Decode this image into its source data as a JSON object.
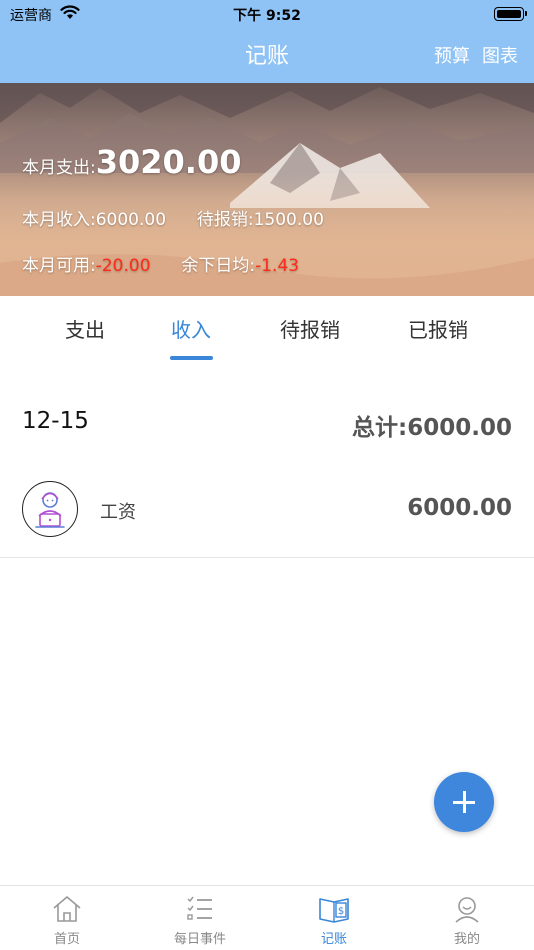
{
  "status_bar": {
    "carrier": "运营商",
    "time": "下午 9:52"
  },
  "nav": {
    "title": "记账",
    "budget": "预算",
    "chart": "图表"
  },
  "summary": {
    "expense_label": "本月支出:",
    "expense_value": "3020.00",
    "income_label": "本月收入:",
    "income_value": "6000.00",
    "pending_label": "待报销:",
    "pending_value": "1500.00",
    "available_label": "本月可用:",
    "available_value": "-20.00",
    "daily_label": "余下日均:",
    "daily_value": "-1.43"
  },
  "tabs": [
    {
      "label": "支出",
      "active": false
    },
    {
      "label": "收入",
      "active": true
    },
    {
      "label": "待报销",
      "active": false
    },
    {
      "label": "已报销",
      "active": false
    }
  ],
  "group": {
    "date": "12-15",
    "total_label": "总计:",
    "total_value": "6000.00"
  },
  "records": [
    {
      "category": "工资",
      "amount": "6000.00",
      "icon": "worker-laptop-icon"
    }
  ],
  "tabbar": [
    {
      "label": "首页",
      "icon": "home-icon",
      "active": false
    },
    {
      "label": "每日事件",
      "icon": "checklist-icon",
      "active": false
    },
    {
      "label": "记账",
      "icon": "ledger-icon",
      "active": true
    },
    {
      "label": "我的",
      "icon": "user-icon",
      "active": false
    }
  ],
  "colors": {
    "nav_bg": "#8fc3f5",
    "accent": "#3a86d8",
    "negative": "#ff2a1a",
    "fab": "#3f86dd"
  }
}
